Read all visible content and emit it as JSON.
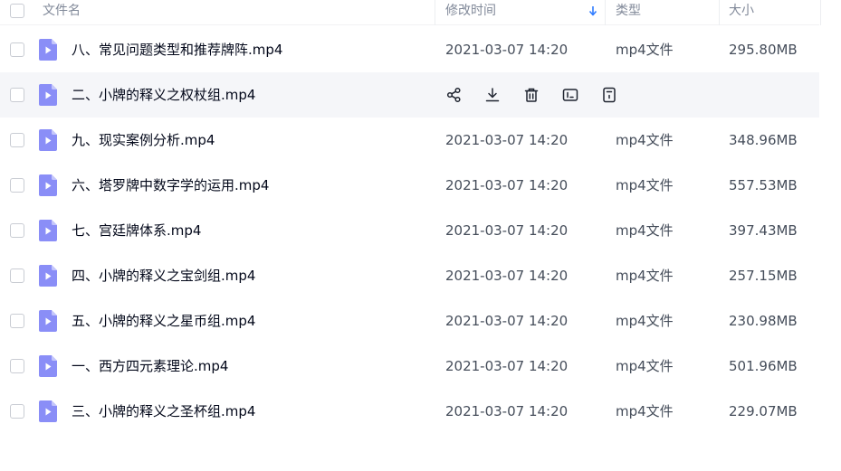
{
  "header": {
    "name": "文件名",
    "modified": "修改时间",
    "type": "类型",
    "size": "大小"
  },
  "files": [
    {
      "name": "八、常见问题类型和推荐牌阵.mp4",
      "time": "2021-03-07 14:20",
      "type": "mp4文件",
      "size": "295.80MB"
    },
    {
      "name": "二、小牌的释义之权杖组.mp4",
      "time": "",
      "type": "",
      "size": "",
      "hovered": true
    },
    {
      "name": "九、现实案例分析.mp4",
      "time": "2021-03-07 14:20",
      "type": "mp4文件",
      "size": "348.96MB"
    },
    {
      "name": "六、塔罗牌中数字学的运用.mp4",
      "time": "2021-03-07 14:20",
      "type": "mp4文件",
      "size": "557.53MB"
    },
    {
      "name": "七、宫廷牌体系.mp4",
      "time": "2021-03-07 14:20",
      "type": "mp4文件",
      "size": "397.43MB"
    },
    {
      "name": "四、小牌的释义之宝剑组.mp4",
      "time": "2021-03-07 14:20",
      "type": "mp4文件",
      "size": "257.15MB"
    },
    {
      "name": "五、小牌的释义之星币组.mp4",
      "time": "2021-03-07 14:20",
      "type": "mp4文件",
      "size": "230.98MB"
    },
    {
      "name": "一、西方四元素理论.mp4",
      "time": "2021-03-07 14:20",
      "type": "mp4文件",
      "size": "501.96MB"
    },
    {
      "name": "三、小牌的释义之圣杯组.mp4",
      "time": "2021-03-07 14:20",
      "type": "mp4文件",
      "size": "229.07MB"
    }
  ],
  "hover_actions": [
    "share-icon",
    "download-icon",
    "delete-icon",
    "rename-icon",
    "more-icon"
  ],
  "sort": {
    "column": "modified",
    "direction": "desc",
    "indicator_color": "#2f7bff"
  },
  "colors": {
    "file_icon": "#8a8ef7",
    "file_icon_fold": "#c4c6fb",
    "text_primary": "#03081a",
    "text_secondary": "#454d5a",
    "header_text": "#818999",
    "hover_row": "#f5f6f9"
  }
}
